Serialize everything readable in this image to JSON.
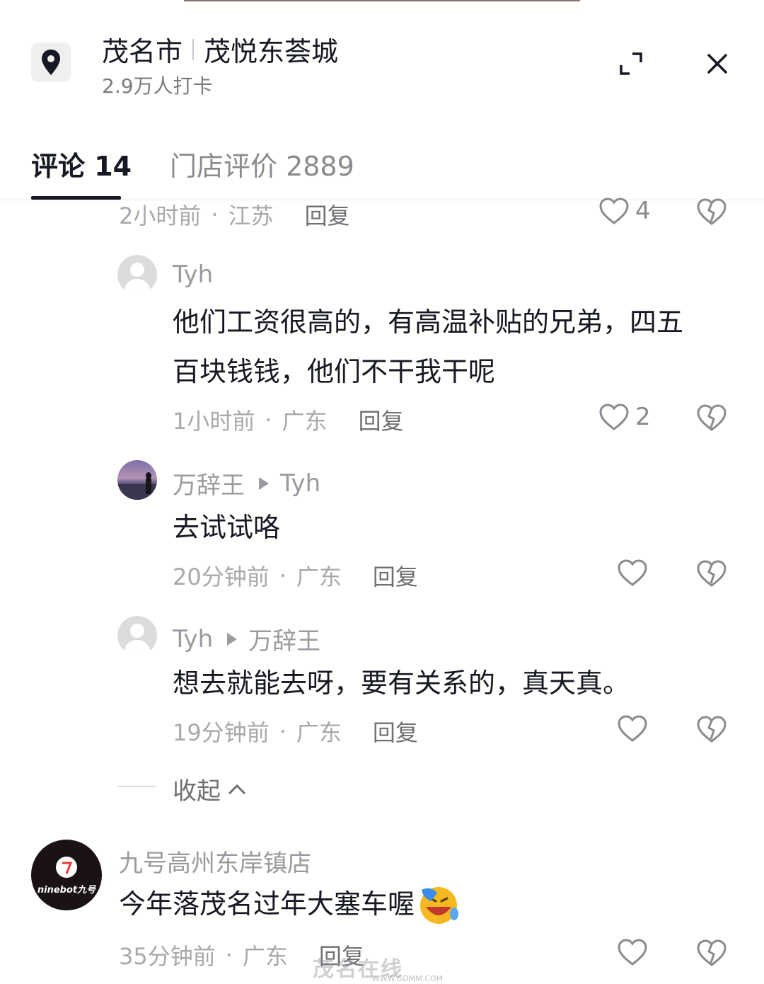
{
  "header": {
    "city": "茂名市",
    "place": "茂悦东荟城",
    "checkins": "2.9万人打卡"
  },
  "tabs": [
    {
      "label": "评论 14",
      "active": true
    },
    {
      "label": "门店评价 2889",
      "active": false
    }
  ],
  "comments": [
    {
      "time": "2小时前",
      "region": "江苏",
      "reply_label": "回复",
      "likes": "4"
    },
    {
      "author": "Tyh",
      "text_line1": "他们工资很高的，有高温补贴的兄弟，四五",
      "text_line2": "百块钱钱，他们不干我干呢",
      "time": "1小时前",
      "region": "广东",
      "reply_label": "回复",
      "likes": "2"
    },
    {
      "author": "万辞王",
      "reply_to": "Tyh",
      "text": "去试试咯",
      "time": "20分钟前",
      "region": "广东",
      "reply_label": "回复"
    },
    {
      "author": "Tyh",
      "reply_to": "万辞王",
      "text": "想去就能去呀，要有关系的，真天真。",
      "time": "19分钟前",
      "region": "广东",
      "reply_label": "回复"
    },
    {
      "author": "九号高州东岸镇店",
      "avatar_text": "ninebot九号",
      "text": "今年落茂名过年大塞车喔",
      "time": "35分钟前",
      "region": "广东",
      "reply_label": "回复"
    }
  ],
  "collapse_label": "收起",
  "dot_sep": "·",
  "watermark": {
    "main": "茂名在线",
    "sub": "WWW.GDMM.COM"
  },
  "colors": {
    "text": "#161823",
    "muted": "#a8a8ae",
    "accent_emoji": "#f5b820"
  }
}
